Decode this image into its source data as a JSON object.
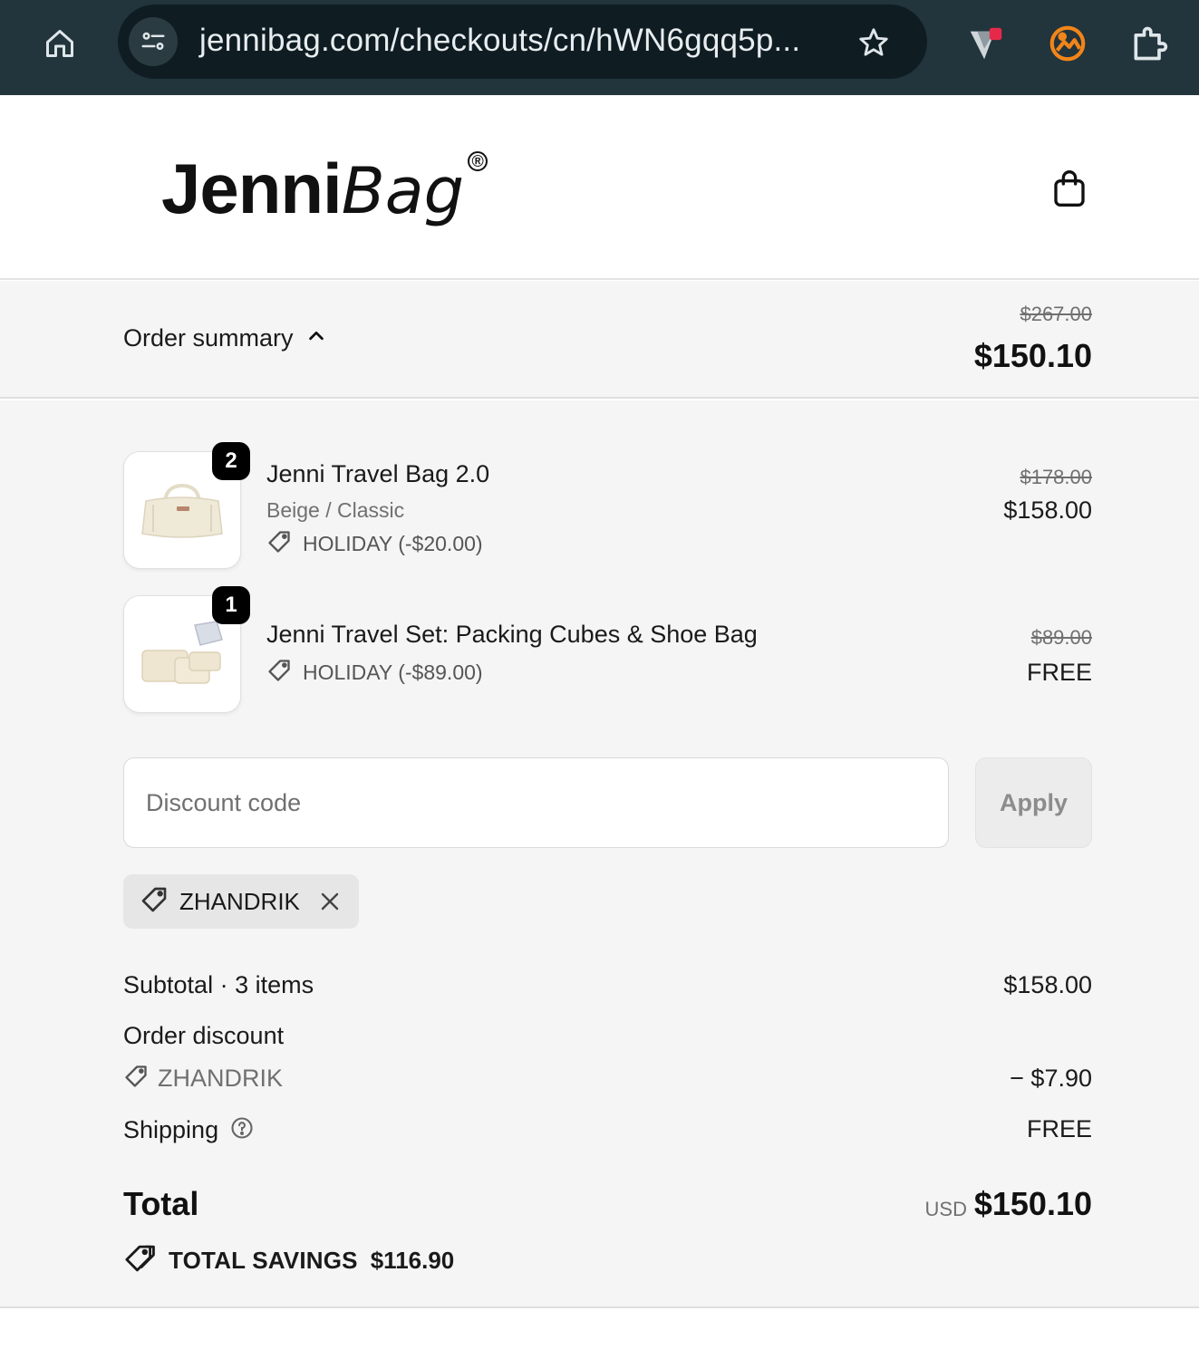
{
  "browser": {
    "url": "jennibag.com/checkouts/cn/hWN6gqq5p...",
    "icons": [
      "home-icon",
      "site-info-icon",
      "star-icon",
      "extension-bookmark-icon",
      "extension-image-icon",
      "extensions-puzzle-icon"
    ],
    "colors": {
      "bar": "#22343c",
      "pill": "#0f1d23",
      "ext_accent": "#f08519"
    }
  },
  "header": {
    "logo_bold": "Jenni",
    "logo_italic": "Bag",
    "logo_mark": "®",
    "cart_icon": "shopping-bag-icon"
  },
  "summary": {
    "toggle_label": "Order summary",
    "original_total": "$267.00",
    "total": "$150.10"
  },
  "items": [
    {
      "quantity": "2",
      "title": "Jenni Travel Bag 2.0",
      "variant": "Beige / Classic",
      "discount": "HOLIDAY (-$20.00)",
      "original_price": "$178.00",
      "price": "$158.00"
    },
    {
      "quantity": "1",
      "title": "Jenni Travel Set: Packing Cubes & Shoe Bag",
      "variant": "",
      "discount": "HOLIDAY (-$89.00)",
      "original_price": "$89.00",
      "price": "FREE"
    }
  ],
  "discount_form": {
    "placeholder": "Discount code",
    "apply_label": "Apply"
  },
  "applied_code": "ZHANDRIK",
  "totals": {
    "subtotal_label": "Subtotal · 3 items",
    "subtotal_value": "$158.00",
    "order_discount_label": "Order discount",
    "order_discount_code": "ZHANDRIK",
    "order_discount_value": "− $7.90",
    "shipping_label": "Shipping",
    "shipping_value": "FREE",
    "total_label": "Total",
    "currency": "USD",
    "total_value": "$150.10",
    "savings_label": "TOTAL SAVINGS",
    "savings_value": "$116.90"
  }
}
